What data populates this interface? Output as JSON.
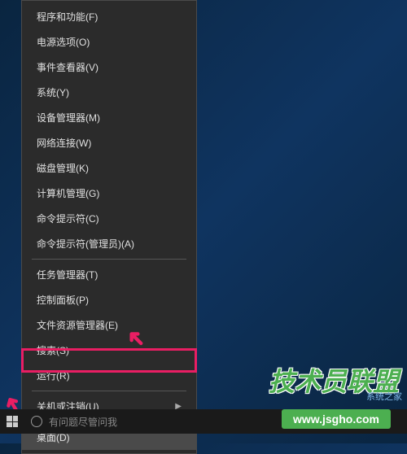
{
  "menu": {
    "items": [
      {
        "label": "程序和功能(F)",
        "type": "item"
      },
      {
        "label": "电源选项(O)",
        "type": "item"
      },
      {
        "label": "事件查看器(V)",
        "type": "item"
      },
      {
        "label": "系统(Y)",
        "type": "item"
      },
      {
        "label": "设备管理器(M)",
        "type": "item"
      },
      {
        "label": "网络连接(W)",
        "type": "item"
      },
      {
        "label": "磁盘管理(K)",
        "type": "item"
      },
      {
        "label": "计算机管理(G)",
        "type": "item"
      },
      {
        "label": "命令提示符(C)",
        "type": "item"
      },
      {
        "label": "命令提示符(管理员)(A)",
        "type": "item"
      },
      {
        "type": "separator"
      },
      {
        "label": "任务管理器(T)",
        "type": "item"
      },
      {
        "label": "控制面板(P)",
        "type": "item"
      },
      {
        "label": "文件资源管理器(E)",
        "type": "item"
      },
      {
        "label": "搜索(S)",
        "type": "item"
      },
      {
        "label": "运行(R)",
        "type": "item",
        "highlighted": true
      },
      {
        "type": "separator"
      },
      {
        "label": "关机或注销(U)",
        "type": "item",
        "submenu": true
      },
      {
        "type": "separator"
      },
      {
        "label": "桌面(D)",
        "type": "item",
        "highlighted": true
      }
    ]
  },
  "taskbar": {
    "search_placeholder": "有问题尽管问我"
  },
  "watermark": {
    "main": "技术员联盟",
    "url": "www.jsgho.com",
    "small": "系统之家"
  },
  "annotations": {
    "arrow": "➜"
  }
}
